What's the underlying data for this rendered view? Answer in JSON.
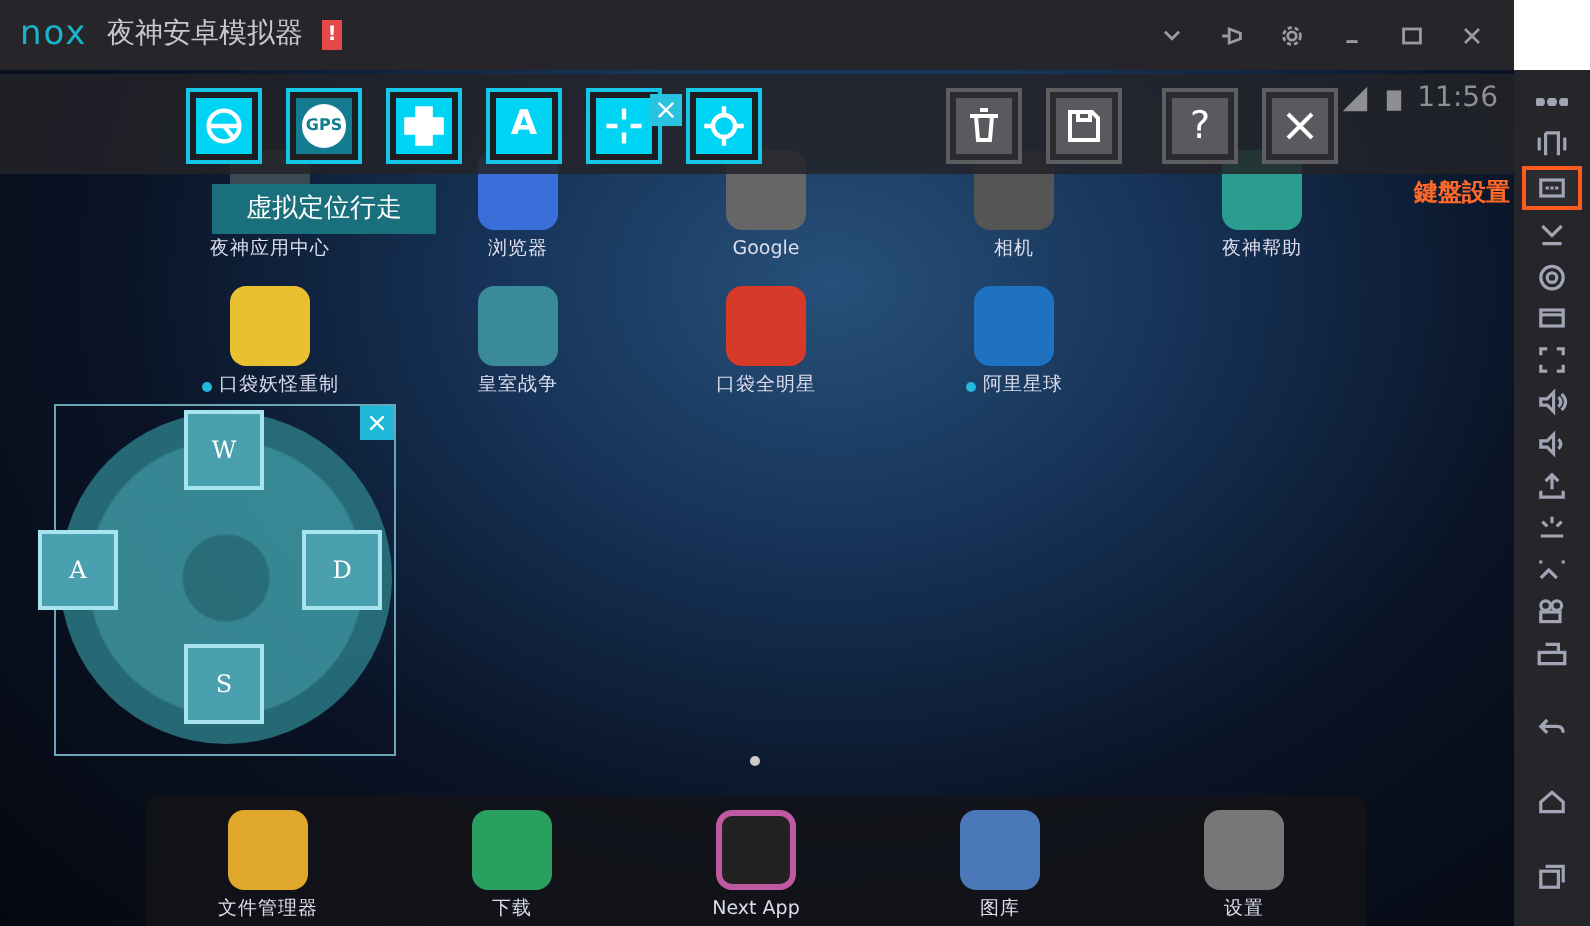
{
  "window": {
    "logo": "nox",
    "title": "夜神安卓模拟器",
    "alert": "!"
  },
  "status_bar": {
    "time": "11:56"
  },
  "key_toolbar": {
    "tools": [
      {
        "kind": "steering",
        "selected": false
      },
      {
        "kind": "gps",
        "label": "GPS",
        "selected": true
      },
      {
        "kind": "dpad",
        "selected": false
      },
      {
        "kind": "key",
        "label": "A",
        "selected": false
      },
      {
        "kind": "crosshair",
        "selected": false
      },
      {
        "kind": "aim",
        "selected": false
      }
    ],
    "actions": [
      {
        "kind": "delete"
      },
      {
        "kind": "save"
      },
      {
        "kind": "help",
        "label": "?"
      },
      {
        "kind": "close"
      }
    ],
    "tooltip": "虚拟定位行走"
  },
  "apps": [
    {
      "name": "夜神应用中心",
      "new": false
    },
    {
      "name": "浏览器",
      "new": false
    },
    {
      "name": "Google",
      "new": false
    },
    {
      "name": "相机",
      "new": false
    },
    {
      "name": "夜神帮助",
      "new": false
    },
    {
      "name": "口袋妖怪重制",
      "new": true
    },
    {
      "name": "皇室战争",
      "new": false
    },
    {
      "name": "口袋全明星",
      "new": false
    },
    {
      "name": "阿里星球",
      "new": true
    }
  ],
  "dpad": {
    "keys": [
      "W",
      "A",
      "D",
      "S"
    ]
  },
  "dock": [
    {
      "name": "文件管理器"
    },
    {
      "name": "下载"
    },
    {
      "name": "Next App"
    },
    {
      "name": "图库"
    },
    {
      "name": "设置"
    }
  ],
  "sidebar": {
    "tooltip": "鍵盤設置",
    "items": [
      {
        "kind": "more",
        "selected": false
      },
      {
        "kind": "shake",
        "selected": false
      },
      {
        "kind": "keyboard",
        "selected": true
      },
      {
        "kind": "chevron",
        "selected": false
      },
      {
        "kind": "location",
        "selected": false
      },
      {
        "kind": "window",
        "selected": false
      },
      {
        "kind": "fullscreen",
        "selected": false
      },
      {
        "kind": "volume-up",
        "selected": false
      },
      {
        "kind": "volume-down",
        "selected": false
      },
      {
        "kind": "install",
        "selected": false
      },
      {
        "kind": "screenshot",
        "selected": false
      },
      {
        "kind": "video",
        "selected": false
      },
      {
        "kind": "record",
        "selected": false
      },
      {
        "kind": "printer",
        "selected": false
      },
      {
        "kind": "back",
        "selected": false
      },
      {
        "kind": "home",
        "selected": false
      },
      {
        "kind": "recents",
        "selected": false
      }
    ]
  }
}
